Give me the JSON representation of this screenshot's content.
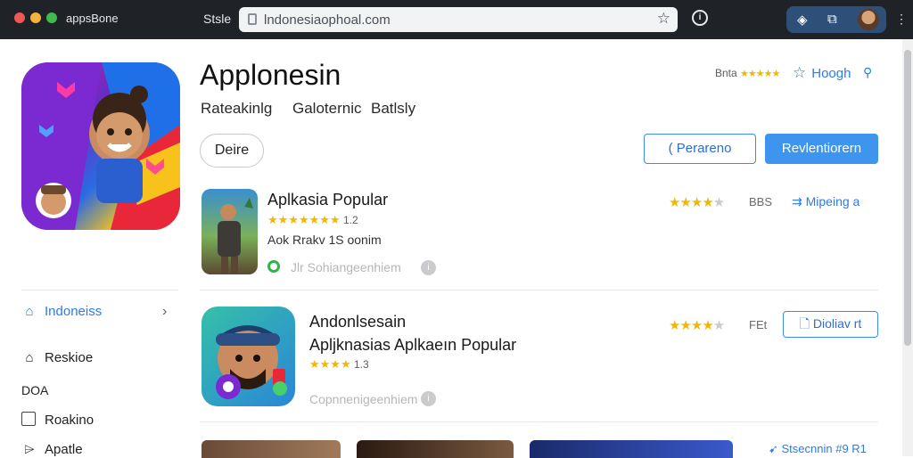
{
  "browser": {
    "app_name": "appsBone",
    "nav_label": "Stsle",
    "url": "lndonesiaophoal.com",
    "menu_glyph": "⋮"
  },
  "app": {
    "title": "Applonesin",
    "meta": [
      "Rateakinlg",
      "Galoternic",
      "Batlsly"
    ],
    "rating_label": "Bnta",
    "rating_stars": "★★★★★",
    "header_action": "Hoogh",
    "chip_label": "Deire",
    "outline_button": "( Perareno",
    "solid_button": "Revlentiorern"
  },
  "items": [
    {
      "title": "Aplkasia Popular",
      "stars": "★★★★★★★",
      "rating_value": "1.2",
      "info": "Aok Rrakv  1S oonim",
      "status": "Jlr Sohiangeenhiem",
      "right_stars": "★★★★",
      "right_off": "★",
      "right_count": "BBS",
      "right_link": "Mipeing a"
    },
    {
      "title": "Andonlsesain",
      "subtitle": "Apljknasias Aplkaeın Popular",
      "stars": "★★★★",
      "rating_value": "1.3",
      "status": "Copnnenigeenhiem",
      "right_stars": "★★★★",
      "right_off": "★",
      "right_count": "FEt",
      "button": "Dioliav rt"
    }
  ],
  "sidebar": {
    "items": [
      {
        "label": "Indoneiss",
        "icon": "home-icon",
        "active": true
      },
      {
        "label": "Reskioe",
        "icon": "house-outline-icon",
        "active": false
      },
      {
        "label": "DOA",
        "icon": "",
        "active": false
      },
      {
        "label": "Roakino",
        "icon": "checkbox-icon",
        "active": false
      },
      {
        "label": "Apatle",
        "icon": "tag-icon",
        "active": false
      }
    ]
  },
  "footer": {
    "link": "Stsecnnin #9 R1"
  },
  "colors": {
    "accent": "#2e7be8",
    "star": "#f2b705",
    "topbar": "#1f2227"
  }
}
